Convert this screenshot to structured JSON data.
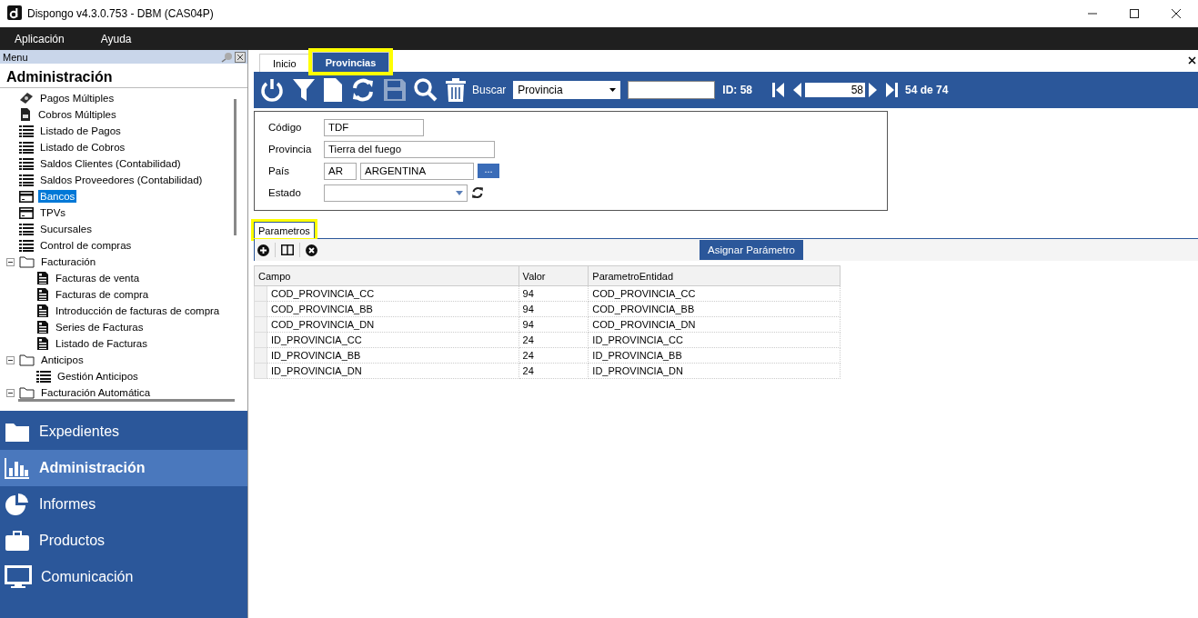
{
  "window": {
    "title": "Dispongo v4.3.0.753 - DBM (CAS04P)"
  },
  "menubar": [
    "Aplicación",
    "Ayuda"
  ],
  "sidebar": {
    "panel_title": "Menu",
    "heading": "Administración",
    "tree": [
      {
        "label": "Pagos Múltiples",
        "kind": "payment",
        "selected": false
      },
      {
        "label": "Cobros Múltiples",
        "kind": "receipt",
        "selected": false
      },
      {
        "label": "Listado de Pagos",
        "kind": "list",
        "selected": false
      },
      {
        "label": "Listado de Cobros",
        "kind": "list",
        "selected": false
      },
      {
        "label": "Saldos Clientes (Contabilidad)",
        "kind": "list",
        "selected": false
      },
      {
        "label": "Saldos Proveedores (Contabilidad)",
        "kind": "list",
        "selected": false
      },
      {
        "label": "Bancos",
        "kind": "card",
        "selected": true
      },
      {
        "label": "TPVs",
        "kind": "card",
        "selected": false
      },
      {
        "label": "Sucursales",
        "kind": "list",
        "selected": false
      },
      {
        "label": "Control de compras",
        "kind": "list",
        "selected": false
      },
      {
        "label": "Facturación",
        "kind": "folder",
        "selected": false,
        "expanded": true,
        "children": [
          {
            "label": "Facturas de venta",
            "kind": "invoice",
            "selected": false
          },
          {
            "label": "Facturas de compra",
            "kind": "invoice",
            "selected": false
          },
          {
            "label": "Introducción de facturas de compra",
            "kind": "invoice",
            "selected": false
          },
          {
            "label": "Series de Facturas",
            "kind": "invoice",
            "selected": false
          },
          {
            "label": "Listado de Facturas",
            "kind": "invoice",
            "selected": false
          }
        ]
      },
      {
        "label": "Anticipos",
        "kind": "folder",
        "selected": false,
        "expanded": true,
        "children": [
          {
            "label": "Gestión Anticipos",
            "kind": "list",
            "selected": false
          }
        ]
      },
      {
        "label": "Facturación Automática",
        "kind": "folder",
        "selected": false,
        "expanded": true
      }
    ],
    "nav": [
      {
        "label": "Expedientes",
        "kind": "folder",
        "selected": false
      },
      {
        "label": "Administración",
        "kind": "chart",
        "selected": true
      },
      {
        "label": "Informes",
        "kind": "pie",
        "selected": false
      },
      {
        "label": "Productos",
        "kind": "briefcase",
        "selected": false
      },
      {
        "label": "Comunicación",
        "kind": "monitor",
        "selected": false
      }
    ]
  },
  "tabs": [
    {
      "label": "Inicio",
      "selected": false,
      "highlighted": false
    },
    {
      "label": "Provincias",
      "selected": true,
      "highlighted": true
    }
  ],
  "toolbar": {
    "search_label": "Buscar",
    "search_field": "Provincia",
    "id_label": "ID: 58",
    "record": "58",
    "count": "54 de 74"
  },
  "form": {
    "fields": [
      {
        "label": "Código",
        "kind": "text",
        "value": "TDF"
      },
      {
        "label": "Provincia",
        "kind": "text",
        "value": "Tierra del fuego"
      },
      {
        "label": "País",
        "kind": "lookup",
        "code": "AR",
        "value": "ARGENTINA",
        "button": "..."
      },
      {
        "label": "Estado",
        "kind": "select"
      }
    ]
  },
  "subtabs": [
    {
      "label": "Parametros",
      "selected": true,
      "highlighted": true
    }
  ],
  "assign_button": "Asignar Parámetro",
  "table": {
    "columns": [
      "Campo",
      "Valor",
      "ParametroEntidad"
    ],
    "rows": [
      [
        "COD_PROVINCIA_CC",
        "94",
        "COD_PROVINCIA_CC"
      ],
      [
        "COD_PROVINCIA_BB",
        "94",
        "COD_PROVINCIA_BB"
      ],
      [
        "COD_PROVINCIA_DN",
        "94",
        "COD_PROVINCIA_DN"
      ],
      [
        "ID_PROVINCIA_CC",
        "24",
        "ID_PROVINCIA_CC"
      ],
      [
        "ID_PROVINCIA_BB",
        "24",
        "ID_PROVINCIA_BB"
      ],
      [
        "ID_PROVINCIA_DN",
        "24",
        "ID_PROVINCIA_DN"
      ]
    ]
  }
}
